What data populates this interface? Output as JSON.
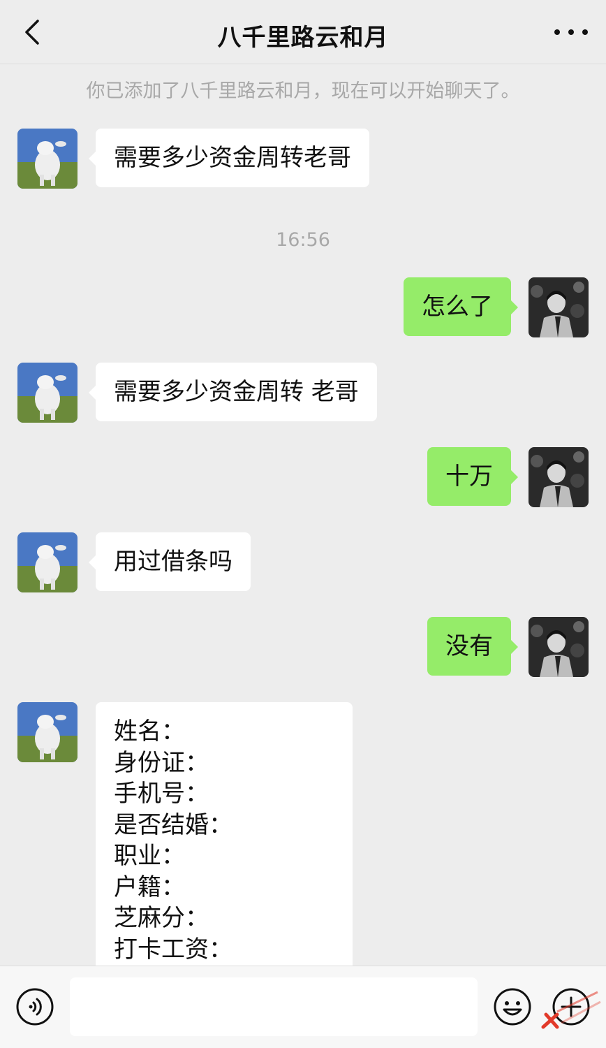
{
  "header": {
    "title": "八千里路云和月",
    "back_icon": "chevron-left-icon",
    "more_icon": "more-dots-icon"
  },
  "chat": {
    "system_notice": "你已添加了八千里路云和月，现在可以开始聊天了。",
    "timestamp": "16:56",
    "messages": [
      {
        "side": "in",
        "text": "需要多少资金周转老哥"
      },
      {
        "side": "out",
        "text": "怎么了"
      },
      {
        "side": "in",
        "text": "需要多少资金周转 老哥"
      },
      {
        "side": "out",
        "text": "十万"
      },
      {
        "side": "in",
        "text": "用过借条吗"
      },
      {
        "side": "out",
        "text": "没有"
      }
    ],
    "form_message": {
      "side": "in",
      "lines": [
        "姓名：",
        "身份证：",
        "手机号：",
        "是否结婚：",
        "职业：",
        "户籍：",
        "芝麻分：",
        "打卡工资："
      ]
    }
  },
  "input_bar": {
    "value": "",
    "voice_icon": "voice-icon",
    "emoji_icon": "emoji-icon",
    "plus_icon": "plus-icon"
  },
  "colors": {
    "background": "#ededed",
    "incoming_bubble": "#ffffff",
    "outgoing_bubble": "#95ec69",
    "muted_text": "#a8a8a8"
  }
}
